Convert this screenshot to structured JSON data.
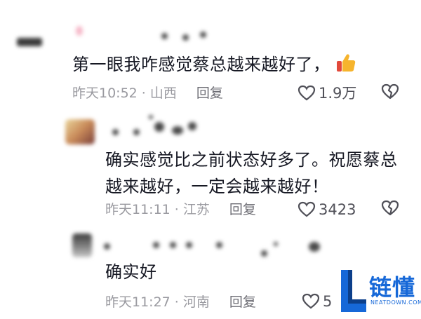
{
  "comments": [
    {
      "text": "第一眼我咋感觉蔡总越来越好了，",
      "time": "昨天10:52",
      "location": "山西",
      "reply_label": "回复",
      "likes": "1.9万"
    },
    {
      "text_line1": "确实感觉比之前状态好多了。祝愿蔡总",
      "text_line2": "越来越好，一定会越来越好！",
      "time": "昨天11:11",
      "location": "江苏",
      "reply_label": "回复",
      "likes": "3423"
    },
    {
      "text": "确实好",
      "time": "昨天11:27",
      "location": "河南",
      "reply_label": "回复",
      "likes": "5"
    }
  ],
  "watermark": {
    "name": "链懂",
    "domain": "NEATDOWN.COM",
    "color": "#1668d8"
  },
  "icons": {
    "like": "heart-outline-icon",
    "dislike": "broken-heart-icon",
    "emoji": "thumbs-up-icon"
  }
}
